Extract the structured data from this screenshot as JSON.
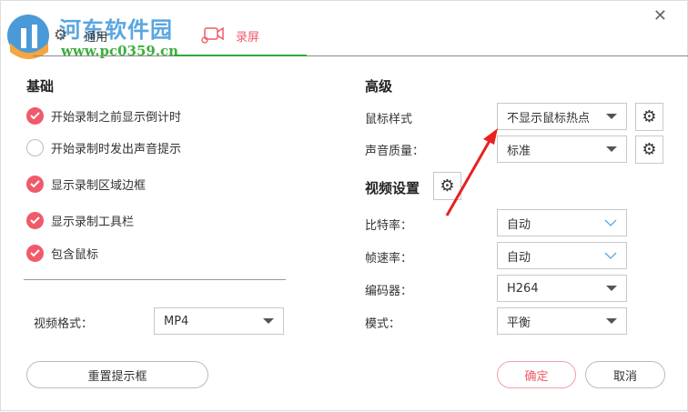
{
  "watermark": {
    "title": "河东软件园",
    "url": "www.pc0359.cn"
  },
  "tabs": [
    {
      "label": "通用"
    },
    {
      "label": "录屏"
    }
  ],
  "basic": {
    "heading": "基础",
    "options": [
      {
        "label": "开始录制之前显示倒计时",
        "checked": true
      },
      {
        "label": "开始录制时发出声音提示",
        "checked": false
      },
      {
        "label": "显示录制区域边框",
        "checked": true
      },
      {
        "label": "显示录制工具栏",
        "checked": true
      },
      {
        "label": "包含鼠标",
        "checked": true
      }
    ],
    "format_label": "视频格式：",
    "format_value": "MP4"
  },
  "advanced": {
    "heading": "高级",
    "cursor_label": "鼠标样式",
    "cursor_value": "不显示鼠标热点",
    "audio_label": "声音质量：",
    "audio_value": "标准"
  },
  "video": {
    "heading": "视频设置",
    "bitrate_label": "比特率：",
    "bitrate_value": "自动",
    "fps_label": "帧速率：",
    "fps_value": "自动",
    "codec_label": "编码器：",
    "codec_value": "H264",
    "mode_label": "模式：",
    "mode_value": "平衡"
  },
  "buttons": {
    "reset": "重置提示框",
    "ok": "确定",
    "cancel": "取消"
  },
  "colors": {
    "accent": "#f05a6a",
    "green": "#2eaa3a"
  }
}
